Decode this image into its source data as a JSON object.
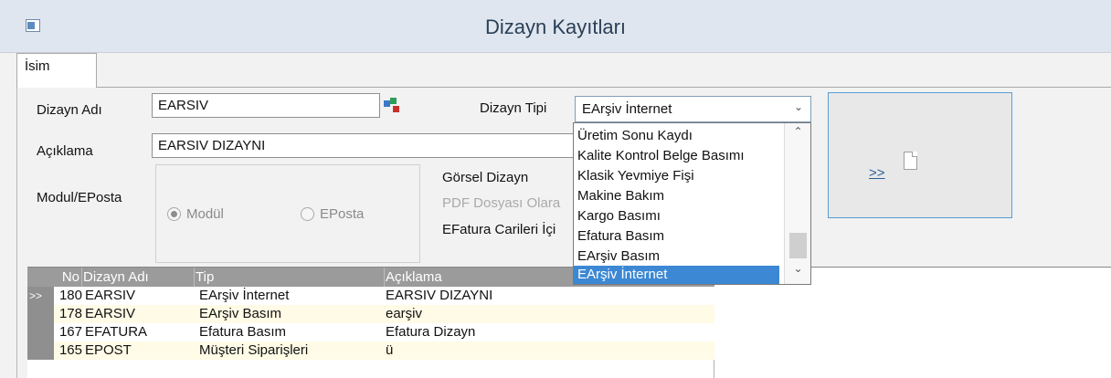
{
  "window": {
    "title": "Dizayn Kayıtları"
  },
  "tabs": [
    {
      "label": "İsim"
    }
  ],
  "form": {
    "dizayn_adi_label": "Dizayn Adı",
    "dizayn_adi_value": "EARSIV",
    "dizayn_tipi_label": "Dizayn Tipi",
    "dizayn_tipi_value": "EArşiv İnternet",
    "aciklama_label": "Açıklama",
    "aciklama_value": "EARSIV DIZAYNI",
    "modul_label": "Modul/EPosta",
    "radio_modul": "Modül",
    "radio_eposta": "EPosta",
    "radio_selected": "Modül",
    "gorsel_dizayn": "Görsel Dizayn",
    "pdf_dosyasi": "PDF Dosyası Olara",
    "efatura_carileri": "EFatura Carileri İçi"
  },
  "dropdown": {
    "items": [
      "Üretim Sonu Kaydı",
      "Kalite Kontrol Belge Basımı",
      "Klasik Yevmiye Fişi",
      "Makine Bakım",
      "Kargo Basımı",
      "Efatura Basım",
      "EArşiv Basım",
      "EArşiv İnternet"
    ],
    "selected": "EArşiv İnternet"
  },
  "action_button": {
    "label": ">>",
    "icon": "document-icon"
  },
  "grid": {
    "columns": [
      "No",
      "Dizayn Adı",
      "Tip",
      "Açıklama"
    ],
    "rows": [
      {
        "indicator": ">>",
        "no": "180",
        "name": "EARSIV",
        "tip": "EArşiv İnternet",
        "aciklama": "EARSIV DIZAYNI"
      },
      {
        "indicator": "",
        "no": "178",
        "name": "EARSIV",
        "tip": "EArşiv Basım",
        "aciklama": "earşiv"
      },
      {
        "indicator": "",
        "no": "167",
        "name": "EFATURA",
        "tip": "Efatura Basım",
        "aciklama": "Efatura Dizayn"
      },
      {
        "indicator": "",
        "no": "165",
        "name": "EPOST",
        "tip": "Müşteri Siparişleri",
        "aciklama": "ü"
      }
    ]
  },
  "colors": {
    "titlebar": "#dfe6ef",
    "selection": "#3c88d4",
    "grid_header": "#9b9b9b",
    "row_alt": "#fffbe6",
    "button_border": "#5b9bd5"
  }
}
